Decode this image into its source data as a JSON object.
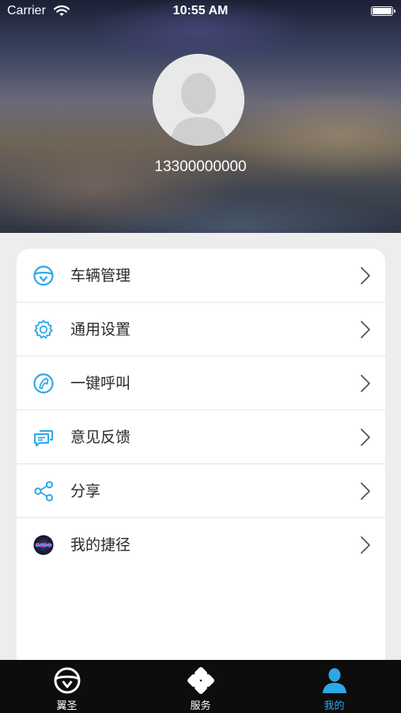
{
  "status_bar": {
    "carrier": "Carrier",
    "time": "10:55 AM",
    "wifi_icon": "wifi-icon",
    "battery_icon": "battery-icon"
  },
  "profile": {
    "avatar_icon": "default-avatar-icon",
    "phone": "13300000000"
  },
  "menu": {
    "items": [
      {
        "label": "车辆管理",
        "icon": "steering-wheel-icon"
      },
      {
        "label": "通用设置",
        "icon": "gear-icon"
      },
      {
        "label": "一键呼叫",
        "icon": "phone-call-icon"
      },
      {
        "label": "意见反馈",
        "icon": "feedback-chat-icon"
      },
      {
        "label": "分享",
        "icon": "share-icon"
      },
      {
        "label": "我的捷径",
        "icon": "siri-shortcut-icon"
      }
    ],
    "chevron_icon": "chevron-right-icon"
  },
  "tab_bar": {
    "tabs": [
      {
        "label": "翼圣",
        "icon": "steering-wheel-icon",
        "active": false
      },
      {
        "label": "服务",
        "icon": "clover-icon",
        "active": false
      },
      {
        "label": "我的",
        "icon": "person-icon",
        "active": true
      }
    ]
  },
  "colors": {
    "accent": "#2ea7e6",
    "tab_bar_bg": "#0d0d0d",
    "page_bg": "#ededed"
  }
}
